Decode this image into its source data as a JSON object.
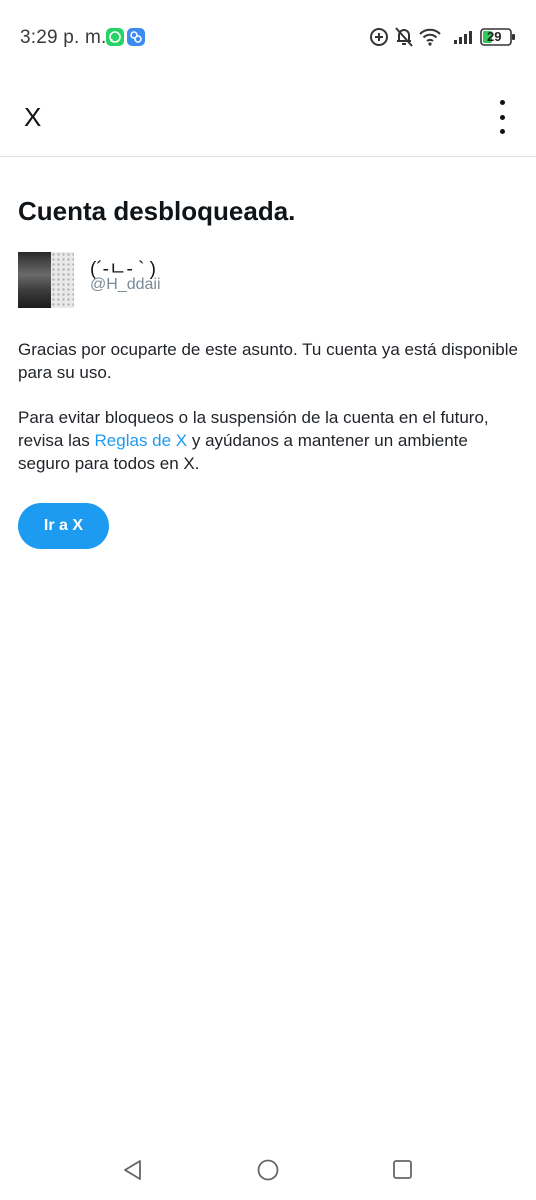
{
  "status_bar": {
    "time": "3:29 p. m.",
    "battery_level": "29",
    "notification_icons": [
      "whatsapp-icon",
      "app-notification-icon"
    ],
    "system_icons": [
      "data-saver-icon",
      "bell-off-icon",
      "wifi-icon",
      "signal-icon",
      "battery-icon"
    ]
  },
  "app_bar": {
    "title": "X",
    "menu_icon": "more-vertical-icon"
  },
  "content": {
    "title": "Cuenta desbloqueada.",
    "profile": {
      "display_name": "(´-ㄴ- ` )",
      "handle": "@H_ddaii"
    },
    "paragraph1": "Gracias por ocuparte de este asunto. Tu cuenta ya está disponible para su uso.",
    "paragraph2_before": "Para evitar bloqueos o la suspensión de la cuenta en el futuro, revisa las ",
    "paragraph2_link": "Reglas de X",
    "paragraph2_after": " y ayúdanos a mantener un ambiente seguro para todos en X.",
    "cta_label": "Ir a X"
  },
  "colors": {
    "accent": "#1d9bf0",
    "text": "#0f1419",
    "secondary_text": "#7a8b98",
    "divider": "#dcdfe3"
  },
  "nav_bar": {
    "icons": [
      "back-icon",
      "home-icon",
      "recents-icon"
    ]
  }
}
